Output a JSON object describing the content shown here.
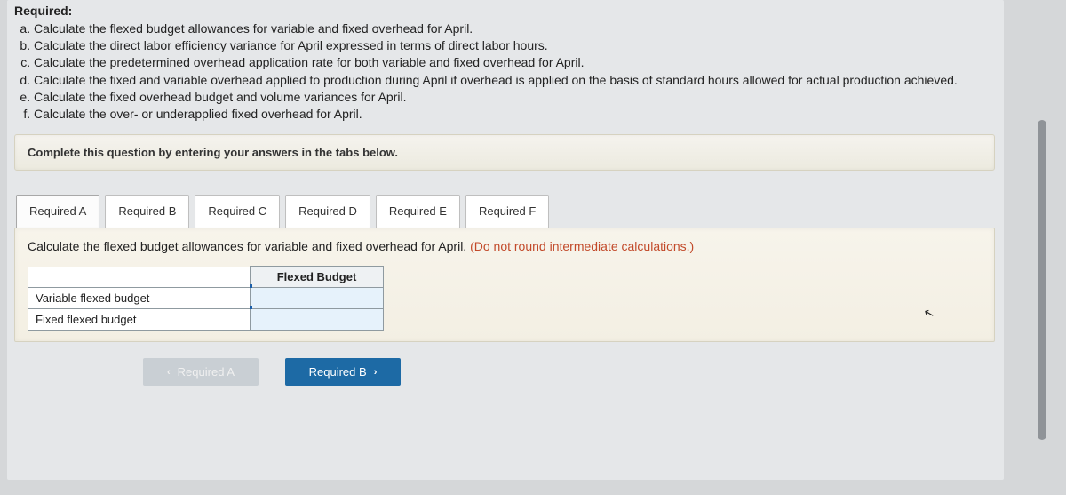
{
  "required_heading": "Required:",
  "required_items": [
    "Calculate the flexed budget allowances for variable and fixed overhead for April.",
    "Calculate the direct labor efficiency variance for April expressed in terms of direct labor hours.",
    "Calculate the predetermined overhead application rate for both variable and fixed overhead for April.",
    "Calculate the fixed and variable overhead applied to production during April if overhead is applied on the basis of standard hours allowed for actual production achieved.",
    "Calculate the fixed overhead budget and volume variances for April.",
    "Calculate the over- or underapplied fixed overhead for April."
  ],
  "instruction": "Complete this question by entering your answers in the tabs below.",
  "tabs": [
    {
      "label": "Required A"
    },
    {
      "label": "Required B"
    },
    {
      "label": "Required C"
    },
    {
      "label": "Required D"
    },
    {
      "label": "Required E"
    },
    {
      "label": "Required F"
    }
  ],
  "panel": {
    "prompt_main": "Calculate the flexed budget allowances for variable and fixed overhead for April. ",
    "prompt_hint": "(Do not round intermediate calculations.)",
    "col_header": "Flexed Budget",
    "rows": [
      "Variable flexed budget",
      "Fixed flexed budget"
    ]
  },
  "pager": {
    "prev": "Required A",
    "next": "Required B"
  }
}
